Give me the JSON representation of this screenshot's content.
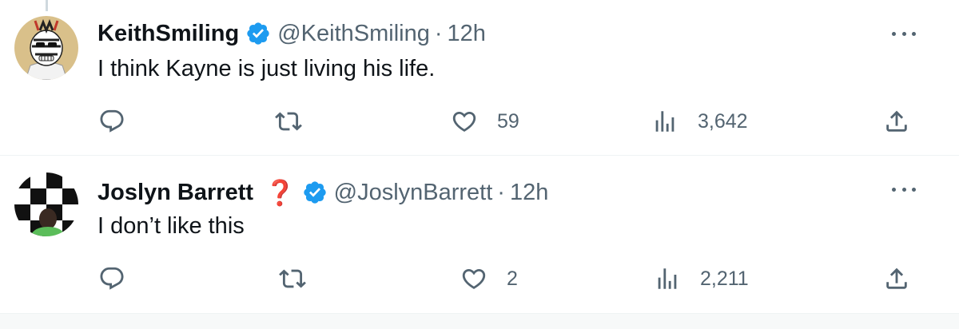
{
  "tweets": [
    {
      "name": "KeithSmiling",
      "emoji": "",
      "handle": "@KeithSmiling",
      "separator": "·",
      "time": "12h",
      "text": "I think Kayne is just living his life.",
      "avatar_icon": "cartoon-zebra-avatar",
      "counts": {
        "replies": "",
        "retweets": "",
        "likes": "59",
        "views": "3,642"
      }
    },
    {
      "name": "Joslyn Barrett",
      "emoji": "❓",
      "handle": "@JoslynBarrett",
      "separator": "·",
      "time": "12h",
      "text": "I don’t like this",
      "avatar_icon": "checkered-background-avatar",
      "counts": {
        "replies": "",
        "retweets": "",
        "likes": "2",
        "views": "2,211"
      }
    }
  ],
  "colors": {
    "verified_blue": "#1d9bf0",
    "text_primary": "#0f1419",
    "text_secondary": "#536471",
    "divider": "#eff3f4"
  }
}
